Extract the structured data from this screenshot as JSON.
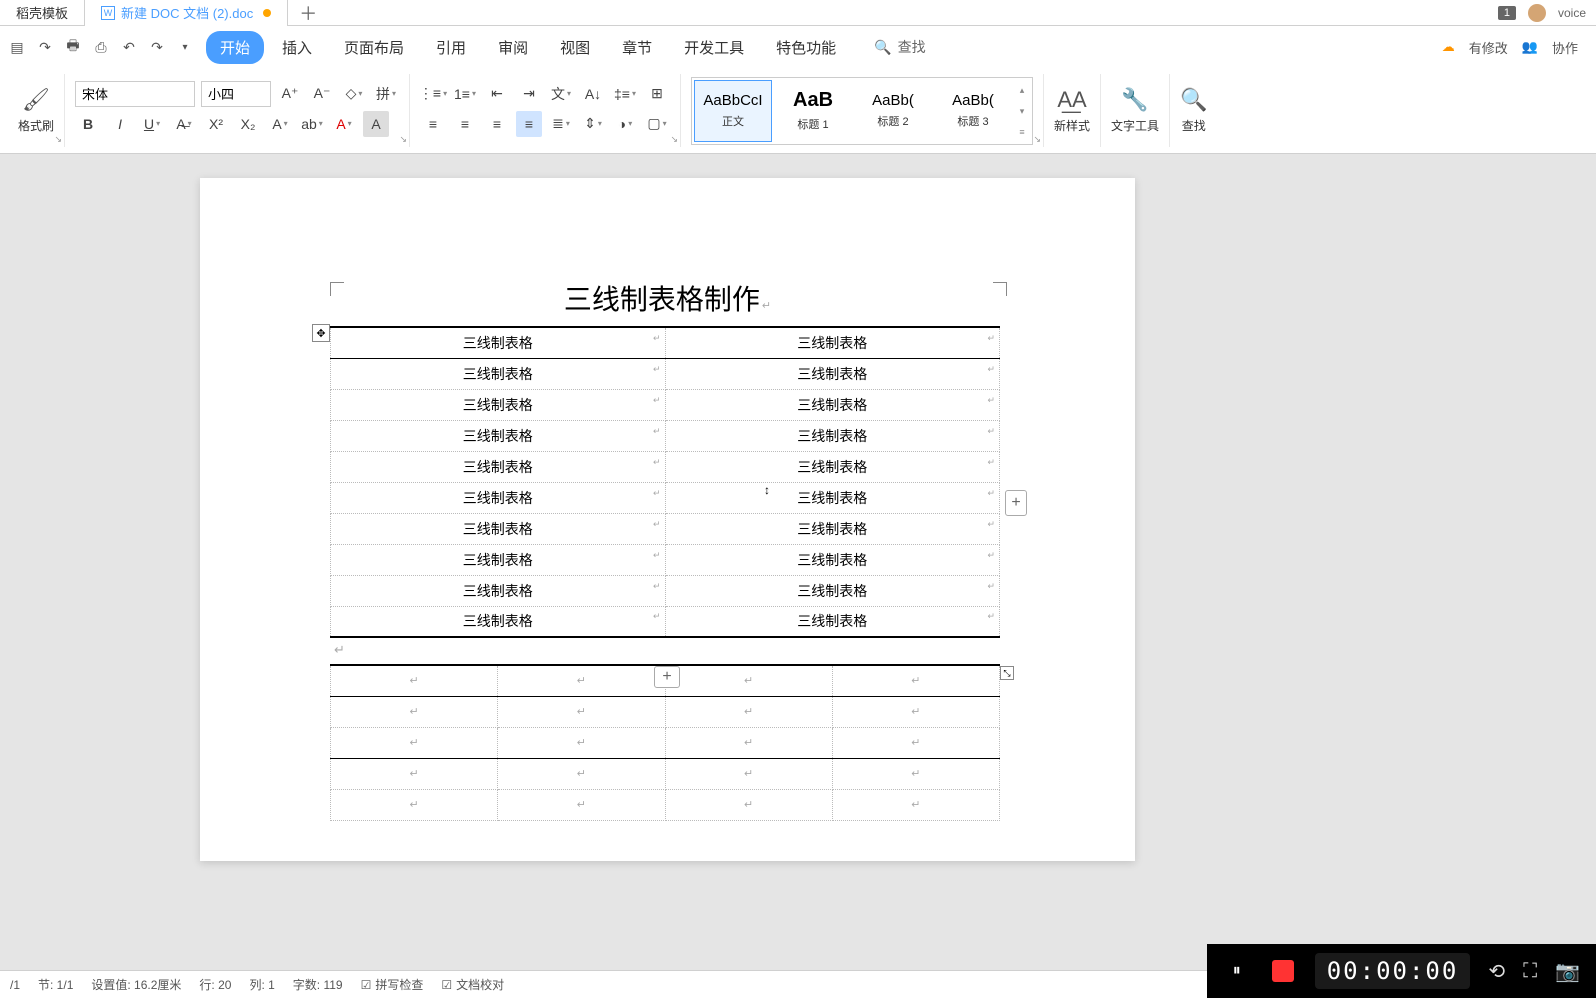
{
  "tabs": {
    "template": "稻壳模板",
    "doc": "新建 DOC 文档 (2).doc",
    "notif": "1",
    "user": "voice"
  },
  "menu": {
    "items": [
      "开始",
      "插入",
      "页面布局",
      "引用",
      "审阅",
      "视图",
      "章节",
      "开发工具",
      "特色功能"
    ],
    "search": "查找",
    "changes": "有修改",
    "collab": "协作"
  },
  "ribbon": {
    "format_painter": "格式刷",
    "font_name": "宋体",
    "font_size": "小四",
    "styles": [
      {
        "preview": "AaBbCcI",
        "name": "正文"
      },
      {
        "preview": "AaB",
        "name": "标题 1"
      },
      {
        "preview": "AaBb(",
        "name": "标题 2"
      },
      {
        "preview": "AaBb(",
        "name": "标题 3"
      }
    ],
    "new_style": "新样式",
    "text_tools": "文字工具",
    "find_replace": "查找"
  },
  "document": {
    "title": "三线制表格制作",
    "cell_text": "三线制表格",
    "table1_rows": 10,
    "table2_rows": 5,
    "table2_cols": 4
  },
  "status": {
    "page": "/1",
    "section": "节: 1/1",
    "setting": "设置值: 16.2厘米",
    "row": "行: 20",
    "col": "列: 1",
    "words": "字数: 119",
    "spell": "拼写检查",
    "proof": "文档校对"
  },
  "recorder": {
    "time": "00:00:00"
  }
}
